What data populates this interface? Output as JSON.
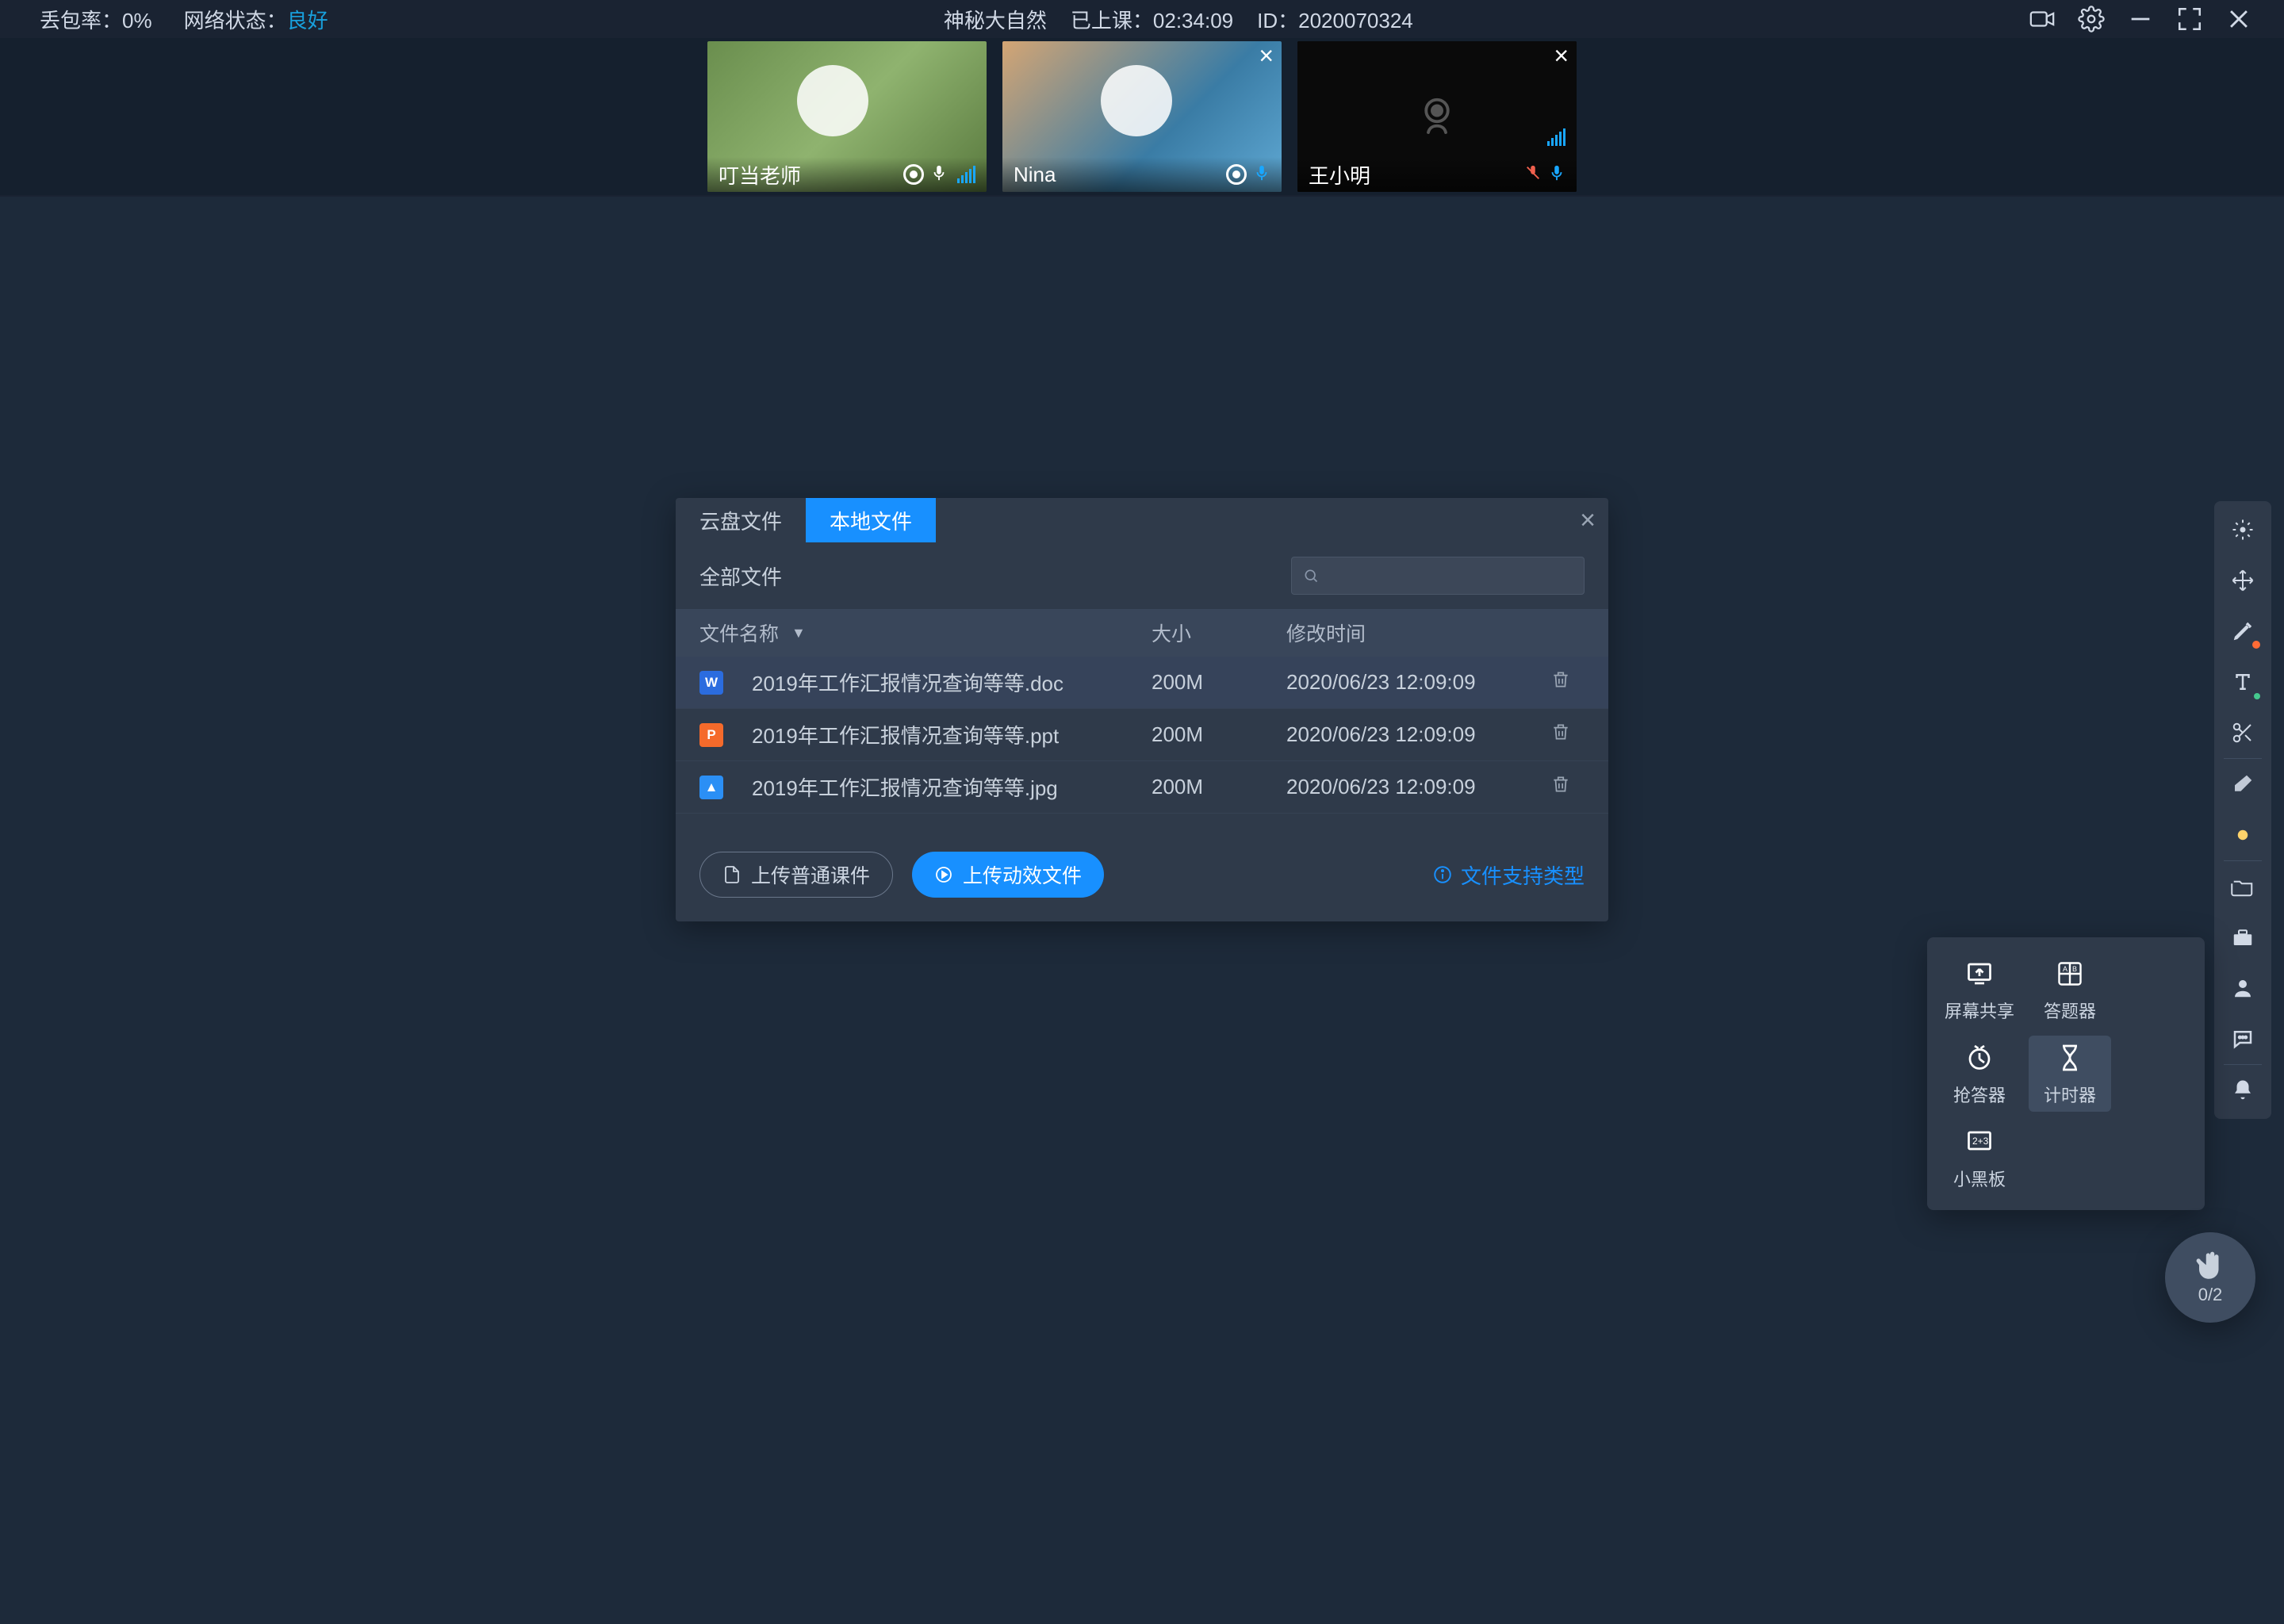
{
  "topbar": {
    "packet_loss_label": "丢包率：0%",
    "net_label": "网络状态：",
    "net_status": "良好",
    "title": "神秘大自然",
    "elapsed_label": "已上课：",
    "elapsed": "02:34:09",
    "id_label": "ID：",
    "id": "2020070324"
  },
  "videos": {
    "teacher_name": "叮当老师",
    "student1_name": "Nina",
    "student2_name": "王小明"
  },
  "dialog": {
    "tab_cloud": "云盘文件",
    "tab_local": "本地文件",
    "all_label": "全部文件",
    "search_placeholder": "",
    "col_name": "文件名称",
    "col_size": "大小",
    "col_time": "修改时间",
    "files": [
      {
        "icon": "doc",
        "iconLetter": "W",
        "name": "2019年工作汇报情况查询等等.doc",
        "size": "200M",
        "time": "2020/06/23 12:09:09"
      },
      {
        "icon": "ppt",
        "iconLetter": "P",
        "name": "2019年工作汇报情况查询等等.ppt",
        "size": "200M",
        "time": "2020/06/23 12:09:09"
      },
      {
        "icon": "jpg",
        "iconLetter": "▲",
        "name": "2019年工作汇报情况查询等等.jpg",
        "size": "200M",
        "time": "2020/06/23 12:09:09"
      }
    ],
    "btn_upload_plain": "上传普通课件",
    "btn_upload_anim": "上传动效文件",
    "support_link": "文件支持类型"
  },
  "tools": {
    "screen_share": "屏幕共享",
    "quiz": "答题器",
    "buzzer": "抢答器",
    "timer": "计时器",
    "blackboard": "小黑板"
  },
  "hand": {
    "count": "0/2"
  }
}
